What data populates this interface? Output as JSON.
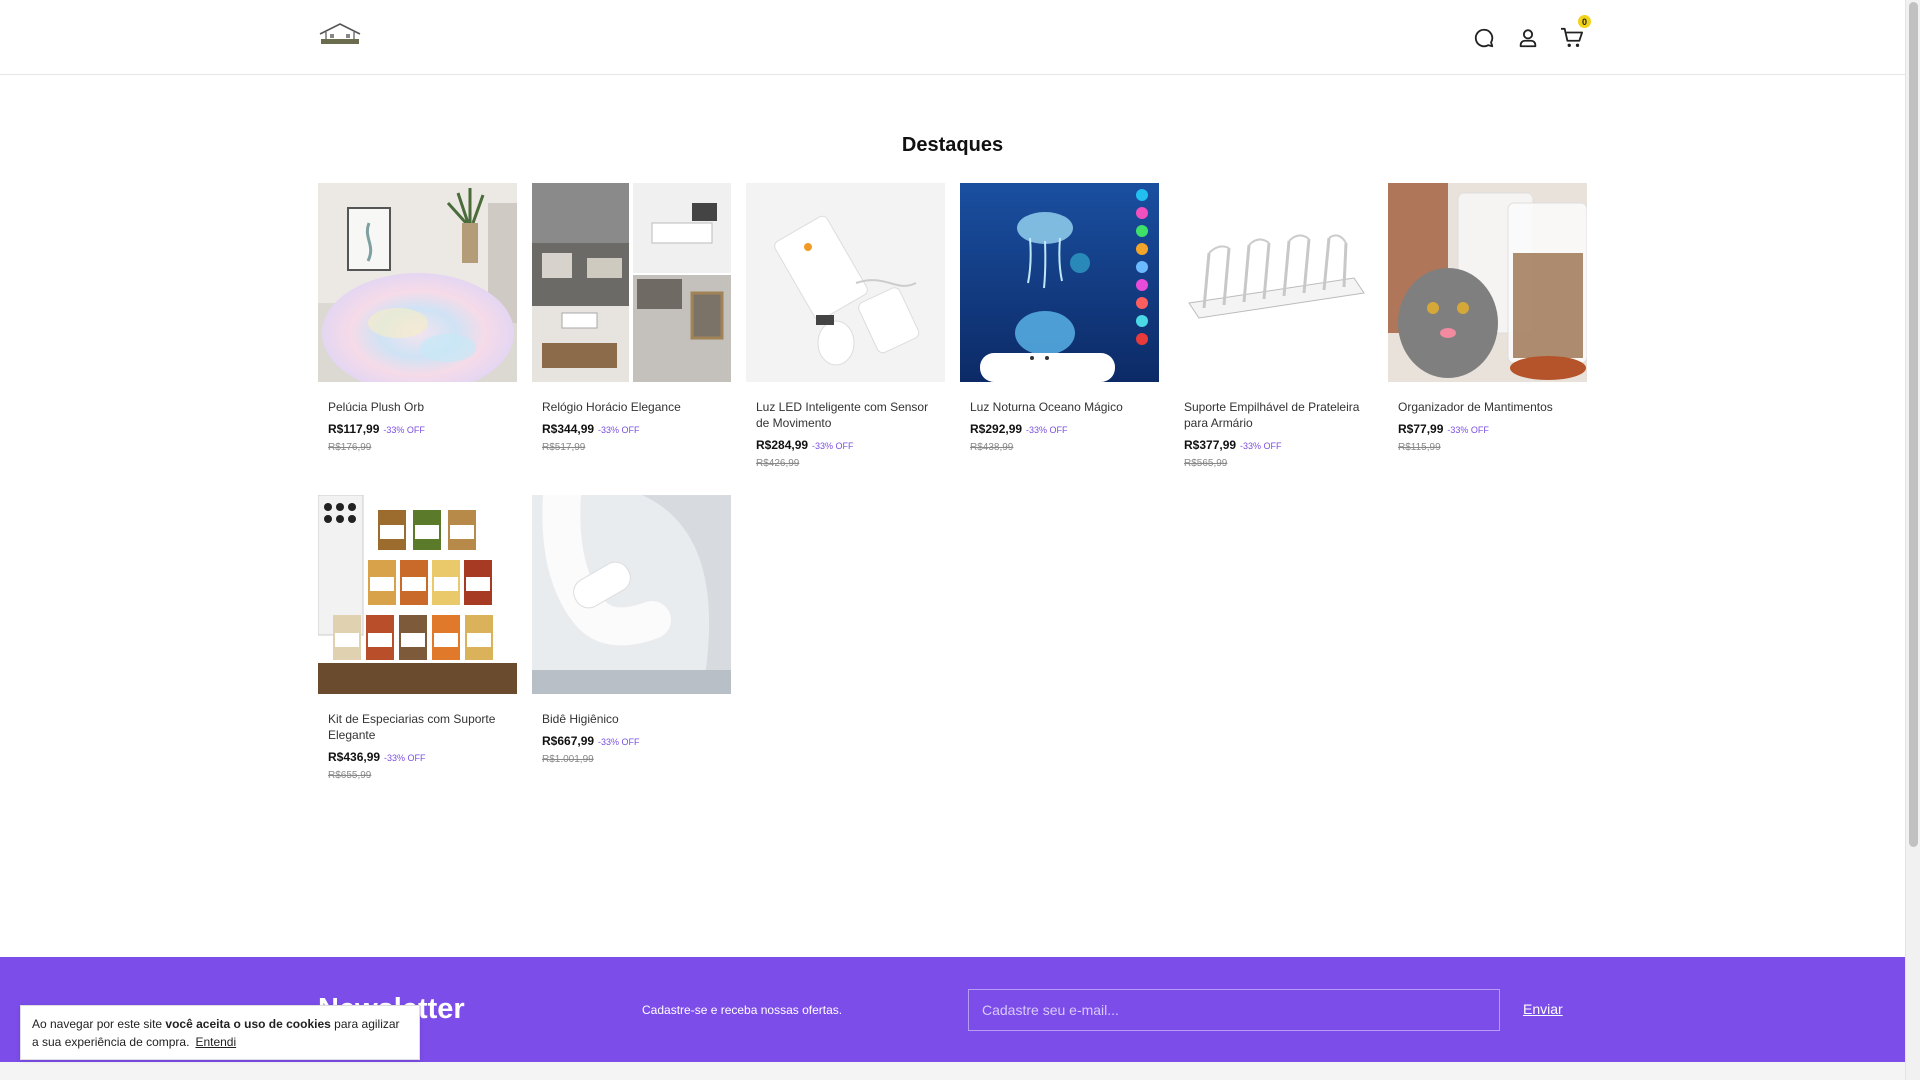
{
  "header": {
    "logo_icon": "house-logo",
    "icons": [
      "chat-icon",
      "user-icon",
      "cart-icon"
    ],
    "cart_count": "0"
  },
  "featured": {
    "title": "Destaques",
    "products": [
      {
        "name": "Pelúcia Plush Orb",
        "price": "R$117,99",
        "discount": "-33% OFF",
        "old_price": "R$176,99"
      },
      {
        "name": "Relógio Horácio Elegance",
        "price": "R$344,99",
        "discount": "-33% OFF",
        "old_price": "R$517,99"
      },
      {
        "name": "Luz LED Inteligente com Sensor de Movimento",
        "price": "R$284,99",
        "discount": "-33% OFF",
        "old_price": "R$426,99"
      },
      {
        "name": "Luz Noturna Oceano Mágico",
        "price": "R$292,99",
        "discount": "-33% OFF",
        "old_price": "R$438,99"
      },
      {
        "name": "Suporte Empilhável de Prateleira para Armário",
        "price": "R$377,99",
        "discount": "-33% OFF",
        "old_price": "R$565,99"
      },
      {
        "name": "Organizador de Mantimentos",
        "price": "R$77,99",
        "discount": "-33% OFF",
        "old_price": "R$115,99"
      },
      {
        "name": "Kit de Especiarias com Suporte Elegante",
        "price": "R$436,99",
        "discount": "-33% OFF",
        "old_price": "R$655,99"
      },
      {
        "name": "Bidê Higiênico",
        "price": "R$667,99",
        "discount": "-33% OFF",
        "old_price": "R$1.001,99"
      }
    ]
  },
  "newsletter": {
    "title": "Newsletter",
    "subtitle": "Cadastre-se e receba nossas ofertas.",
    "placeholder": "Cadastre seu e-mail...",
    "button": "Enviar"
  },
  "cookie": {
    "text_before": "Ao navegar por este site ",
    "text_bold": "você aceita o uso de cookies",
    "text_after": " para agilizar a sua experiência de compra.",
    "accept": "Entendi"
  },
  "colors": {
    "accent": "#7c4de9",
    "discount": "#7b4fe0",
    "badge": "#f3d21a"
  }
}
